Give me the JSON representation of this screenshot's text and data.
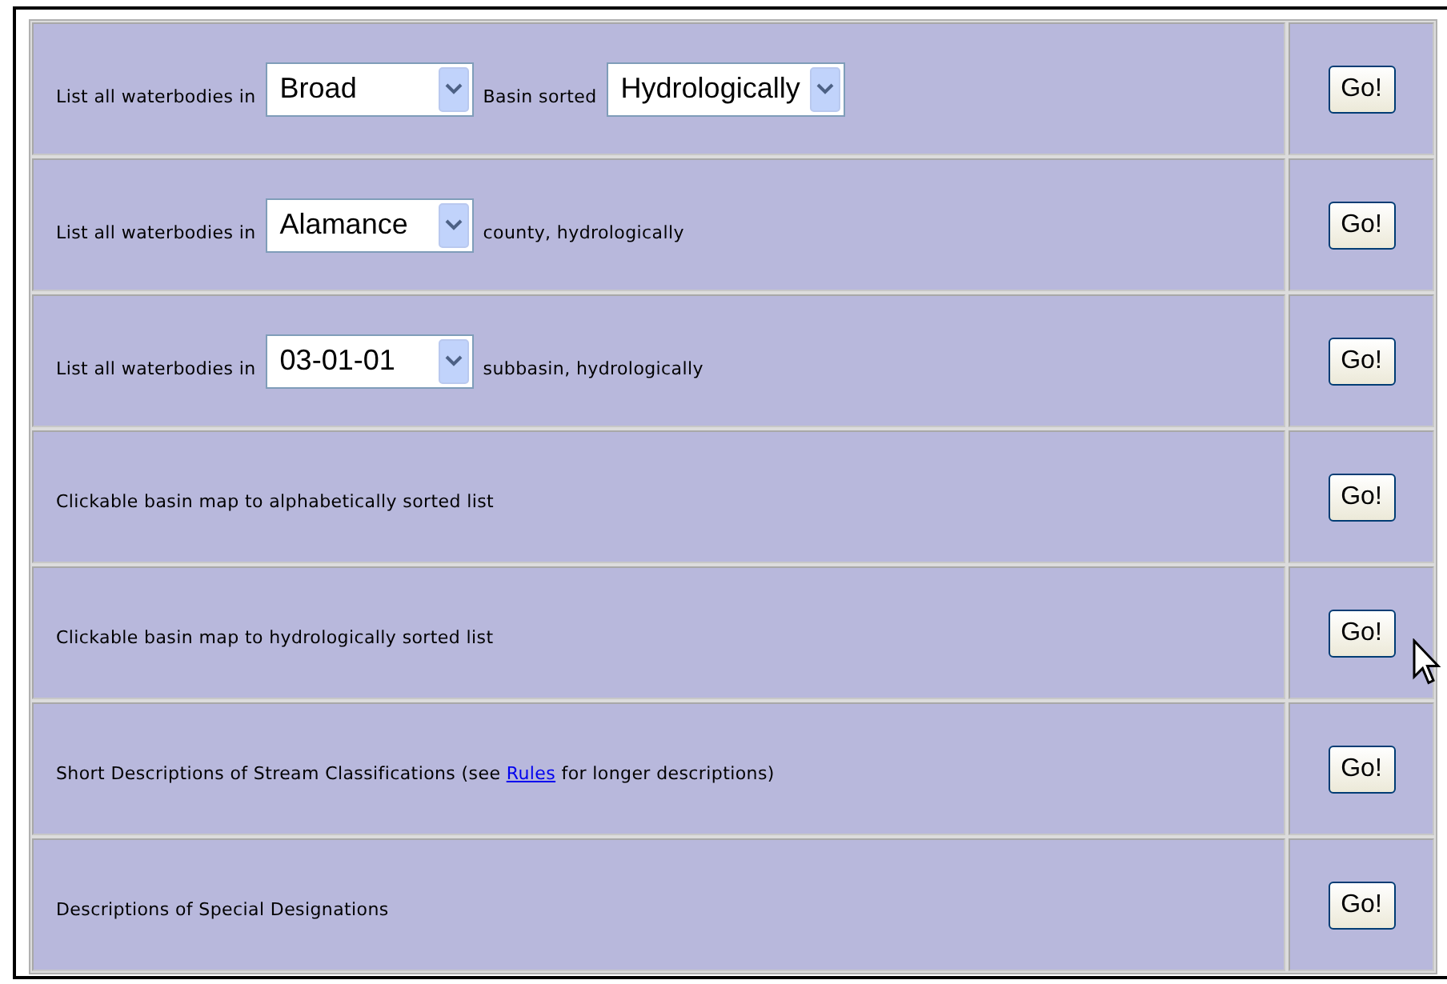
{
  "rows": [
    {
      "parts": [
        {
          "kind": "text",
          "text": "List all waterbodies in"
        },
        {
          "kind": "select",
          "value": "Broad"
        },
        {
          "kind": "text",
          "text": "Basin sorted"
        },
        {
          "kind": "select",
          "value": "Hydrologically"
        }
      ],
      "button": "Go!"
    },
    {
      "parts": [
        {
          "kind": "text",
          "text": "List all waterbodies in"
        },
        {
          "kind": "select",
          "value": "Alamance"
        },
        {
          "kind": "text",
          "text": "county, hydrologically"
        }
      ],
      "button": "Go!"
    },
    {
      "parts": [
        {
          "kind": "text",
          "text": "List all waterbodies in"
        },
        {
          "kind": "select",
          "value": "03-01-01"
        },
        {
          "kind": "text",
          "text": "subbasin, hydrologically"
        }
      ],
      "button": "Go!"
    },
    {
      "parts": [
        {
          "kind": "sentence",
          "segments": [
            {
              "kind": "text",
              "text": "Clickable basin map to alphabetically sorted list"
            }
          ]
        }
      ],
      "button": "Go!"
    },
    {
      "parts": [
        {
          "kind": "sentence",
          "segments": [
            {
              "kind": "text",
              "text": "Clickable basin map to hydrologically sorted list"
            }
          ]
        }
      ],
      "button": "Go!",
      "hovered": true
    },
    {
      "parts": [
        {
          "kind": "sentence",
          "segments": [
            {
              "kind": "text",
              "text": "Short Descriptions of Stream Classifications (see "
            },
            {
              "kind": "link",
              "text": "Rules"
            },
            {
              "kind": "text",
              "text": " for longer descriptions)"
            }
          ]
        }
      ],
      "button": "Go!"
    },
    {
      "parts": [
        {
          "kind": "sentence",
          "segments": [
            {
              "kind": "text",
              "text": "Descriptions of Special Designations"
            }
          ]
        }
      ],
      "button": "Go!"
    }
  ]
}
